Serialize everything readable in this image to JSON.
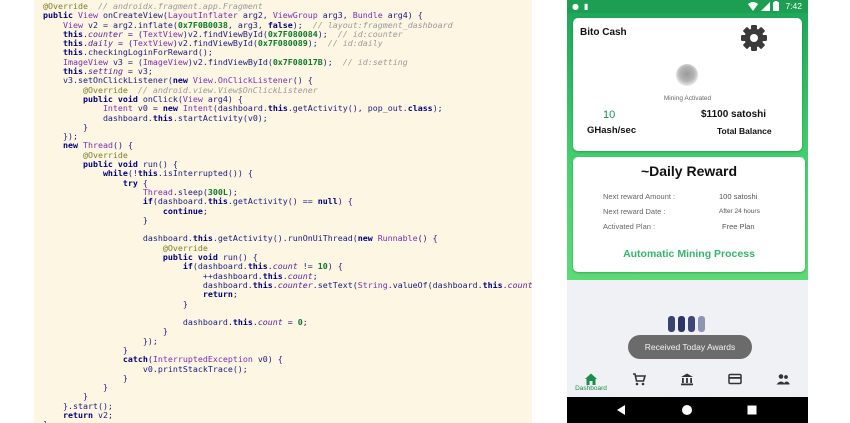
{
  "code": {
    "lines": [
      [
        [
          "@Override",
          "an"
        ],
        [
          "  // androidx.fragment.app.Fragment",
          "cm"
        ]
      ],
      [
        [
          "public ",
          "kw"
        ],
        [
          "View ",
          "ty"
        ],
        [
          "onCreateView(",
          "id"
        ],
        [
          "LayoutInflater ",
          "ty"
        ],
        [
          "arg2, ",
          "id"
        ],
        [
          "ViewGroup ",
          "ty"
        ],
        [
          "arg3, ",
          "id"
        ],
        [
          "Bundle ",
          "ty"
        ],
        [
          "arg4) {",
          "id"
        ]
      ],
      [
        [
          "    View ",
          "ty"
        ],
        [
          "v2 = arg2.inflate(",
          "id"
        ],
        [
          "0x7F0B0038",
          "num"
        ],
        [
          ", arg3, ",
          "id"
        ],
        [
          "false",
          "kw"
        ],
        [
          ");  ",
          "id"
        ],
        [
          "// layout:fragment_dashboard",
          "cm"
        ]
      ],
      [
        [
          "    this",
          "kw"
        ],
        [
          ".",
          "id"
        ],
        [
          "counter",
          "fld"
        ],
        [
          " = (",
          "id"
        ],
        [
          "TextView",
          "ty"
        ],
        [
          ")v2.findViewById(",
          "id"
        ],
        [
          "0x7F080084",
          "num"
        ],
        [
          ");  ",
          "id"
        ],
        [
          "// id:counter",
          "cm"
        ]
      ],
      [
        [
          "    this",
          "kw"
        ],
        [
          ".",
          "id"
        ],
        [
          "daily",
          "fld"
        ],
        [
          " = (",
          "id"
        ],
        [
          "TextView",
          "ty"
        ],
        [
          ")v2.findViewById(",
          "id"
        ],
        [
          "0x7F080089",
          "num"
        ],
        [
          ");  ",
          "id"
        ],
        [
          "// id:daily",
          "cm"
        ]
      ],
      [
        [
          "    this",
          "kw"
        ],
        [
          ".checkingLoginForReward();",
          "id"
        ]
      ],
      [
        [
          "    ImageView ",
          "ty"
        ],
        [
          "v3 = (",
          "id"
        ],
        [
          "ImageView",
          "ty"
        ],
        [
          ")v2.findViewById(",
          "id"
        ],
        [
          "0x7F08017B",
          "num"
        ],
        [
          ");  ",
          "id"
        ],
        [
          "// id:setting",
          "cm"
        ]
      ],
      [
        [
          "    this",
          "kw"
        ],
        [
          ".",
          "id"
        ],
        [
          "setting",
          "fld"
        ],
        [
          " = v3;",
          "id"
        ]
      ],
      [
        [
          "    v3.setOnClickListener(",
          "id"
        ],
        [
          "new ",
          "kw"
        ],
        [
          "View.OnClickListener",
          "ty"
        ],
        [
          "() {",
          "id"
        ]
      ],
      [
        [
          "        @Override",
          "an"
        ],
        [
          "  // android.view.View$OnClickListener",
          "cm"
        ]
      ],
      [
        [
          "        public void ",
          "kw"
        ],
        [
          "onClick(",
          "id"
        ],
        [
          "View ",
          "ty"
        ],
        [
          "arg4) {",
          "id"
        ]
      ],
      [
        [
          "            Intent ",
          "ty"
        ],
        [
          "v0 = ",
          "id"
        ],
        [
          "new ",
          "kw"
        ],
        [
          "Intent",
          "ty"
        ],
        [
          "(dashboard.",
          "id"
        ],
        [
          "this",
          "kw"
        ],
        [
          ".getActivity(), pop_out.",
          "id"
        ],
        [
          "class",
          "kw"
        ],
        [
          ");",
          "id"
        ]
      ],
      [
        [
          "            dashboard.",
          "id"
        ],
        [
          "this",
          "kw"
        ],
        [
          ".startActivity(v0);",
          "id"
        ]
      ],
      [
        [
          "        }",
          "id"
        ]
      ],
      [
        [
          "    });",
          "id"
        ]
      ],
      [
        [
          "    new ",
          "kw"
        ],
        [
          "Thread",
          "ty"
        ],
        [
          "() {",
          "id"
        ]
      ],
      [
        [
          "        @Override",
          "an"
        ]
      ],
      [
        [
          "        public void ",
          "kw"
        ],
        [
          "run() {",
          "id"
        ]
      ],
      [
        [
          "            while",
          "kw"
        ],
        [
          "(!",
          "id"
        ],
        [
          "this",
          "kw"
        ],
        [
          ".isInterrupted()) {",
          "id"
        ]
      ],
      [
        [
          "                try ",
          "kw"
        ],
        [
          "{",
          "id"
        ]
      ],
      [
        [
          "                    Thread",
          "ty"
        ],
        [
          ".sleep(",
          "id"
        ],
        [
          "300L",
          "num"
        ],
        [
          ");",
          "id"
        ]
      ],
      [
        [
          "                    if",
          "kw"
        ],
        [
          "(dashboard.",
          "id"
        ],
        [
          "this",
          "kw"
        ],
        [
          ".getActivity() == ",
          "id"
        ],
        [
          "null",
          "kw"
        ],
        [
          ") {",
          "id"
        ]
      ],
      [
        [
          "                        continue",
          "kw"
        ],
        [
          ";",
          "id"
        ]
      ],
      [
        [
          "                    }",
          "id"
        ]
      ],
      [
        [
          "",
          "id"
        ]
      ],
      [
        [
          "                    dashboard.",
          "id"
        ],
        [
          "this",
          "kw"
        ],
        [
          ".getActivity().runOnUiThread(",
          "id"
        ],
        [
          "new ",
          "kw"
        ],
        [
          "Runnable",
          "ty"
        ],
        [
          "() {",
          "id"
        ]
      ],
      [
        [
          "                        @Override",
          "an"
        ]
      ],
      [
        [
          "                        public void ",
          "kw"
        ],
        [
          "run() {",
          "id"
        ]
      ],
      [
        [
          "                            if",
          "kw"
        ],
        [
          "(dashboard.",
          "id"
        ],
        [
          "this",
          "kw"
        ],
        [
          ".",
          "id"
        ],
        [
          "count",
          "fld"
        ],
        [
          " != ",
          "id"
        ],
        [
          "10",
          "num"
        ],
        [
          ") {",
          "id"
        ]
      ],
      [
        [
          "                                ++dashboard.",
          "id"
        ],
        [
          "this",
          "kw"
        ],
        [
          ".",
          "id"
        ],
        [
          "count",
          "fld"
        ],
        [
          ";",
          "id"
        ]
      ],
      [
        [
          "                                dashboard.",
          "id"
        ],
        [
          "this",
          "kw"
        ],
        [
          ".",
          "id"
        ],
        [
          "counter",
          "fld"
        ],
        [
          ".setText(",
          "id"
        ],
        [
          "String",
          "ty"
        ],
        [
          ".valueOf(dashboard.",
          "id"
        ],
        [
          "this",
          "kw"
        ],
        [
          ".",
          "id"
        ],
        [
          "count",
          "fld"
        ],
        [
          "));",
          "id"
        ]
      ],
      [
        [
          "                                return",
          "kw"
        ],
        [
          ";",
          "id"
        ]
      ],
      [
        [
          "                            }",
          "id"
        ]
      ],
      [
        [
          "",
          "id"
        ]
      ],
      [
        [
          "                            dashboard.",
          "id"
        ],
        [
          "this",
          "kw"
        ],
        [
          ".",
          "id"
        ],
        [
          "count",
          "fld"
        ],
        [
          " = ",
          "id"
        ],
        [
          "0",
          "num"
        ],
        [
          ";",
          "id"
        ]
      ],
      [
        [
          "                        }",
          "id"
        ]
      ],
      [
        [
          "                    });",
          "id"
        ]
      ],
      [
        [
          "                }",
          "id"
        ]
      ],
      [
        [
          "                catch",
          "kw"
        ],
        [
          "(",
          "id"
        ],
        [
          "InterruptedException ",
          "ty"
        ],
        [
          "v0) {",
          "id"
        ]
      ],
      [
        [
          "                    v0.printStackTrace();",
          "id"
        ]
      ],
      [
        [
          "                }",
          "id"
        ]
      ],
      [
        [
          "            }",
          "id"
        ]
      ],
      [
        [
          "        }",
          "id"
        ]
      ],
      [
        [
          "    }.start();",
          "id"
        ]
      ],
      [
        [
          "    return ",
          "kw"
        ],
        [
          "v2;",
          "id"
        ]
      ],
      [
        [
          "}",
          "id"
        ]
      ]
    ]
  },
  "phone": {
    "status_time": "7:42",
    "app_title": "Bito Cash",
    "mining_status": "Mining Activated",
    "hashrate_value": "10",
    "hashrate_unit": "GHash/sec",
    "balance_value": "$1100 satoshi",
    "balance_label": "Total Balance",
    "reward": {
      "title": "~Daily Reward",
      "rows": [
        {
          "label": "Next reward Amount :",
          "value": "100  satoshi"
        },
        {
          "label": "Next reward Date :",
          "value": "After 24 hours"
        },
        {
          "label": "Activated Plan :",
          "value": "Free Plan"
        }
      ],
      "action": "Automatic Mining Process"
    },
    "toast": "Received Today Awards",
    "nav": {
      "dashboard_label": "Dashboard"
    },
    "colors": {
      "primary": "#1e9e52",
      "accent": "#34b56c",
      "loader": [
        "#3a4470",
        "#2c3566",
        "#3e4878",
        "#8d95b3"
      ]
    }
  }
}
